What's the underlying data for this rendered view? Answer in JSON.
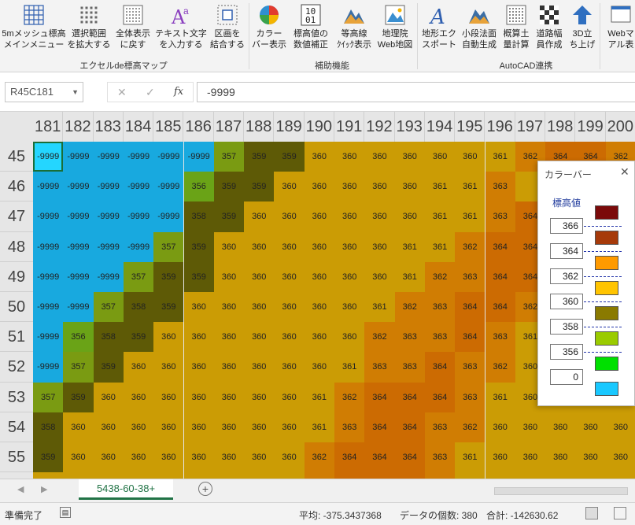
{
  "ribbon": {
    "buttons": [
      {
        "label1": "5mメッシュ標高",
        "label2": "メインメニュー",
        "icon": "mesh-grid-icon"
      },
      {
        "label1": "選択範囲",
        "label2": "を拡大する",
        "icon": "dotted-grid-icon"
      },
      {
        "label1": "全体表示",
        "label2": "に戻す",
        "icon": "full-grid-icon"
      },
      {
        "label1": "テキスト文字",
        "label2": "を入力する",
        "icon": "text-a-icon"
      },
      {
        "label1": "区画を",
        "label2": "結合する",
        "icon": "merge-cells-icon"
      },
      {
        "label1": "カラー",
        "label2": "バー表示",
        "icon": "color-pie-icon"
      },
      {
        "label1": "標高値の",
        "label2": "数値補正",
        "icon": "binary-number-icon"
      },
      {
        "label1": "等高線",
        "label2": "ｸｲｯｸ表示",
        "icon": "contour-mountain-icon"
      },
      {
        "label1": "地理院",
        "label2": "Web地図",
        "icon": "web-map-icon"
      },
      {
        "label1": "地形エク",
        "label2": "スポート",
        "icon": "export-a-icon"
      },
      {
        "label1": "小段法面",
        "label2": "自動生成",
        "icon": "slope-mountain-icon"
      },
      {
        "label1": "概算土",
        "label2": "量計算",
        "icon": "volume-grid-icon"
      },
      {
        "label1": "道路幅",
        "label2": "員作成",
        "icon": "checker-road-icon"
      },
      {
        "label1": "3D立",
        "label2": "ち上げ",
        "icon": "up-arrow-3d-icon"
      },
      {
        "label1": "Webマ",
        "label2": "アル表",
        "icon": "web-manual-icon"
      }
    ],
    "groups": [
      "エクセルde標高マップ",
      "補助機能",
      "AutoCAD連携"
    ]
  },
  "formula_bar": {
    "name_box": "R45C181",
    "formula": "-9999"
  },
  "grid": {
    "columns": [
      "181",
      "182",
      "183",
      "184",
      "185",
      "186",
      "187",
      "188",
      "189",
      "190",
      "191",
      "192",
      "193",
      "194",
      "195",
      "196",
      "197",
      "198",
      "199",
      "200"
    ],
    "rows": [
      "45",
      "46",
      "47",
      "48",
      "49",
      "50",
      "51",
      "52",
      "53",
      "54",
      "55",
      "56"
    ],
    "cells": [
      [
        "-9999",
        "-9999",
        "-9999",
        "-9999",
        "-9999",
        "-9999",
        "357",
        "359",
        "359",
        "360",
        "360",
        "360",
        "360",
        "360",
        "360",
        "361",
        "362",
        "364",
        "364",
        "362"
      ],
      [
        "-9999",
        "-9999",
        "-9999",
        "-9999",
        "-9999",
        "356",
        "359",
        "359",
        "360",
        "360",
        "360",
        "360",
        "360",
        "361",
        "361",
        "363",
        "",
        "",
        "",
        ""
      ],
      [
        "-9999",
        "-9999",
        "-9999",
        "-9999",
        "-9999",
        "358",
        "359",
        "360",
        "360",
        "360",
        "360",
        "360",
        "360",
        "361",
        "361",
        "363",
        "364",
        "",
        "",
        ""
      ],
      [
        "-9999",
        "-9999",
        "-9999",
        "-9999",
        "357",
        "359",
        "360",
        "360",
        "360",
        "360",
        "360",
        "360",
        "361",
        "361",
        "362",
        "364",
        "364",
        "",
        "",
        ""
      ],
      [
        "-9999",
        "-9999",
        "-9999",
        "357",
        "359",
        "359",
        "360",
        "360",
        "360",
        "360",
        "360",
        "360",
        "361",
        "362",
        "363",
        "364",
        "364",
        "",
        "",
        ""
      ],
      [
        "-9999",
        "-9999",
        "357",
        "358",
        "359",
        "360",
        "360",
        "360",
        "360",
        "360",
        "360",
        "361",
        "362",
        "363",
        "364",
        "364",
        "362",
        "",
        "",
        ""
      ],
      [
        "-9999",
        "356",
        "358",
        "359",
        "360",
        "360",
        "360",
        "360",
        "360",
        "360",
        "360",
        "362",
        "363",
        "363",
        "364",
        "363",
        "361",
        "",
        "",
        ""
      ],
      [
        "-9999",
        "357",
        "359",
        "360",
        "360",
        "360",
        "360",
        "360",
        "360",
        "360",
        "361",
        "363",
        "363",
        "364",
        "363",
        "362",
        "360",
        "",
        "",
        ""
      ],
      [
        "357",
        "359",
        "360",
        "360",
        "360",
        "360",
        "360",
        "360",
        "360",
        "361",
        "362",
        "364",
        "364",
        "364",
        "363",
        "361",
        "360",
        "",
        "",
        ""
      ],
      [
        "358",
        "360",
        "360",
        "360",
        "360",
        "360",
        "360",
        "360",
        "360",
        "361",
        "363",
        "364",
        "364",
        "363",
        "362",
        "360",
        "360",
        "360",
        "360",
        "360"
      ],
      [
        "359",
        "360",
        "360",
        "360",
        "360",
        "360",
        "360",
        "360",
        "360",
        "362",
        "364",
        "364",
        "364",
        "363",
        "361",
        "360",
        "360",
        "360",
        "360",
        "360"
      ],
      [
        "360",
        "360",
        "360",
        "360",
        "360",
        "360",
        "360",
        "360",
        "360",
        "362",
        "364",
        "364",
        "364",
        "363",
        "361",
        "360",
        "360",
        "360",
        "360",
        "360"
      ]
    ]
  },
  "color_panel": {
    "title": "カラーバー",
    "label": "標高値",
    "values": [
      "366",
      "364",
      "362",
      "360",
      "358",
      "356",
      "0"
    ],
    "swatches": [
      "#7b0a0a",
      "#a63a0a",
      "#ff9a00",
      "#ffc400",
      "#8a7a00",
      "#9acb00",
      "#00e000",
      "#19c8ff"
    ]
  },
  "colors": {
    "c9999": "#18a9df",
    "c0": "#18a9df",
    "c356": "#6aa317",
    "c357": "#7a9b12",
    "c358": "#5e5a06",
    "c359": "#5e5a06",
    "c360": "#cb9c05",
    "c361": "#cb9c05",
    "c362": "#d07d03",
    "c363": "#d07d03",
    "c364": "#cc6b02",
    "c366": "#7b0a0a",
    "selected": "#24d6ff"
  },
  "sheet_tab": "5438-60-38+",
  "status": {
    "ready": "準備完了",
    "average": "平均: -375.3437368",
    "count": "データの個数: 380",
    "sum": "合計: -142630.62"
  }
}
